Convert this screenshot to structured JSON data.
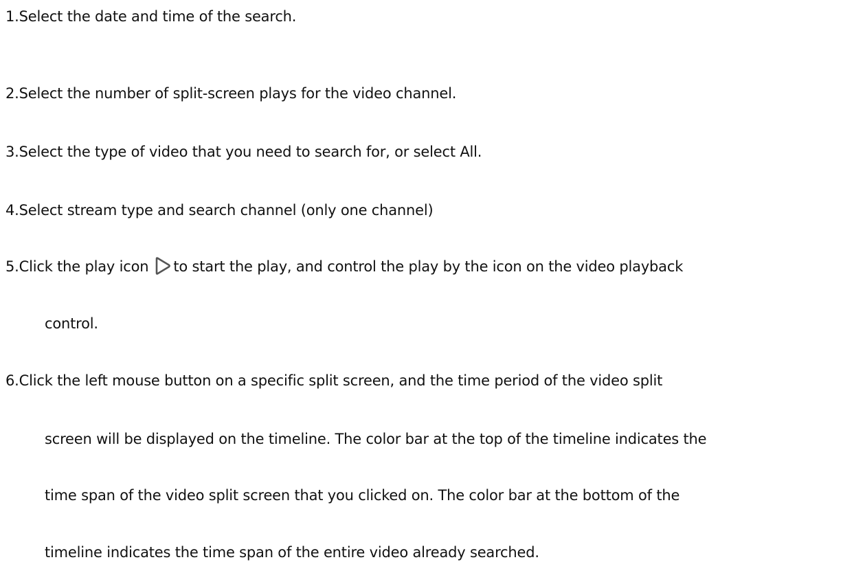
{
  "steps": [
    {
      "lines": [
        "1.Select the date and time of the search."
      ]
    },
    {
      "lines": [
        "2.Select the number of split-screen plays for the video channel."
      ]
    },
    {
      "lines": [
        "3.Select the type of video that you need to search for, or select All."
      ]
    },
    {
      "lines": [
        "4.Select stream type and search channel (only one channel)"
      ]
    },
    {
      "before_icon": "5.Click the play icon",
      "icon": "play-icon",
      "after_icon": "to start the play, and control the play by the icon on the video playback",
      "continuation": "control."
    },
    {
      "lines": [
        "6.Click the left mouse button on a specific split screen, and the time period of the video split",
        "screen will be displayed on the timeline. The color bar at the top of the timeline indicates the",
        "time span of the video split screen that you clicked on. The color bar at the bottom of the",
        "timeline indicates the time span of the entire video already searched."
      ]
    }
  ]
}
